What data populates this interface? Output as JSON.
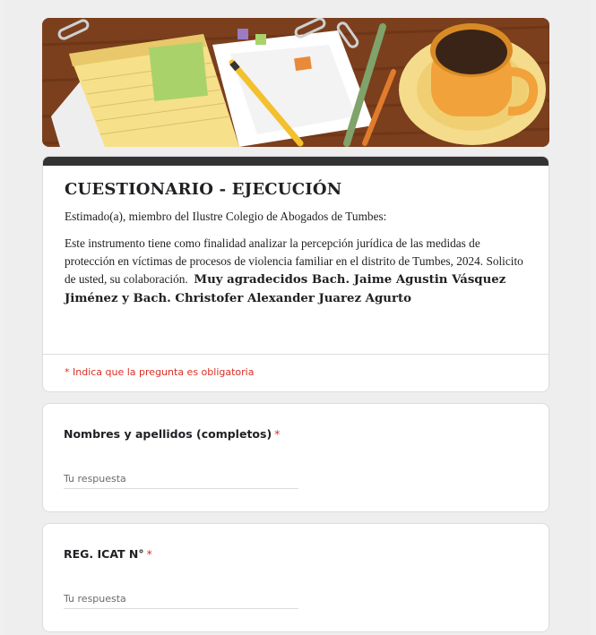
{
  "form": {
    "title": "CUESTIONARIO - EJECUCIÓN",
    "greeting": "Estimado(a), miembro del Ilustre Colegio de Abogados de Tumbes:",
    "description": "Este instrumento tiene como finalidad  analizar la percepción jurídica de las medidas de protección en víctimas de procesos de violencia familiar en el distrito de Tumbes, 2024. Solicito de usted, su colaboración.",
    "thanks": "Muy agradecidos Bach. Jaime Agustin Vásquez Jiménez y Bach. Christofer Alexander Juarez Agurto",
    "required_note": "* Indica que la pregunta es obligatoria"
  },
  "questions": [
    {
      "label": "Nombres y apellidos (completos)",
      "required_mark": "*",
      "placeholder": "Tu respuesta"
    },
    {
      "label": "REG. ICAT N°",
      "required_mark": "*",
      "placeholder": "Tu respuesta"
    }
  ],
  "colors": {
    "header_bar": "#333333",
    "required": "#d93025",
    "banner_wood": "#7a3f1e",
    "notepad": "#f7e08a",
    "mug": "#f2a23a"
  },
  "banner": {
    "theme": "desk-with-notepad-pencil-and-coffee"
  }
}
